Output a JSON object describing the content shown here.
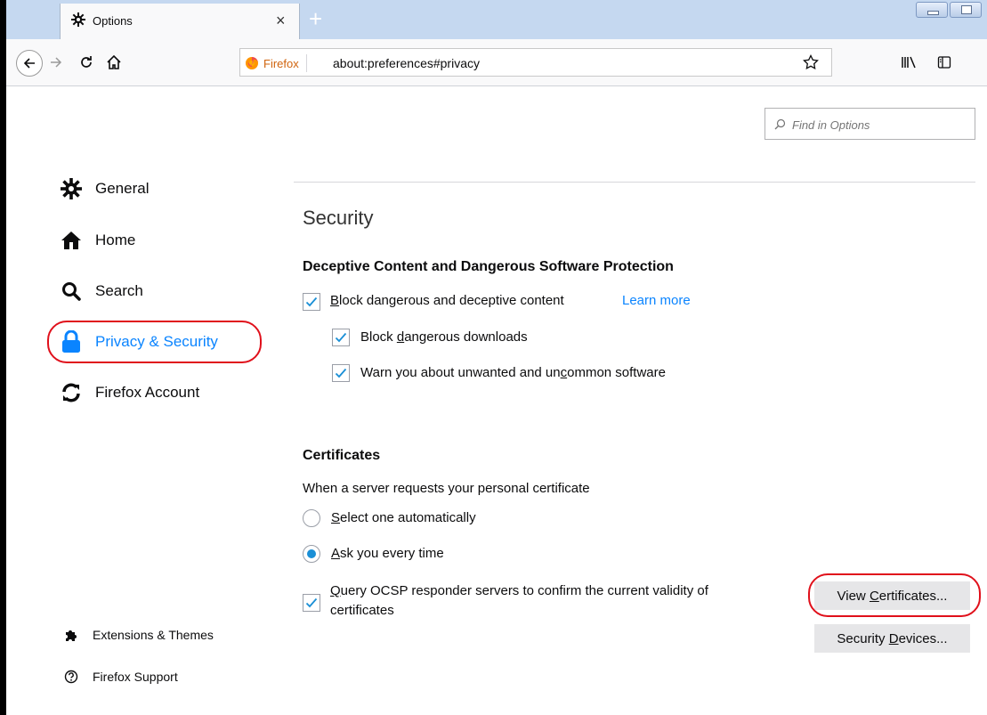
{
  "tab": {
    "title": "Options",
    "close": "×",
    "new_tab": "+"
  },
  "toolbar": {
    "identity_label": "Firefox",
    "url": "about:preferences#privacy"
  },
  "search": {
    "placeholder": "Find in Options"
  },
  "sidebar": {
    "items": [
      {
        "label": "General",
        "icon": "gear-icon"
      },
      {
        "label": "Home",
        "icon": "home-icon"
      },
      {
        "label": "Search",
        "icon": "search-icon"
      },
      {
        "label": "Privacy & Security",
        "icon": "lock-icon",
        "selected": true
      },
      {
        "label": "Firefox Account",
        "icon": "sync-icon"
      }
    ],
    "footer": [
      {
        "label": "Extensions & Themes",
        "icon": "puzzle-icon"
      },
      {
        "label": "Firefox Support",
        "icon": "help-icon"
      }
    ]
  },
  "security": {
    "heading": "Security",
    "deceptive": {
      "heading": "Deceptive Content and Dangerous Software Protection",
      "block_pre": "",
      "block_key": "B",
      "block_post": "lock dangerous and deceptive content",
      "learn_more": "Learn more",
      "downloads_pre": "Block ",
      "downloads_key": "d",
      "downloads_post": "angerous downloads",
      "warn_pre": "Warn you about unwanted and un",
      "warn_key": "c",
      "warn_post": "ommon software"
    },
    "certificates": {
      "heading": "Certificates",
      "description": "When a server requests your personal certificate",
      "auto_pre": "",
      "auto_key": "S",
      "auto_post": "elect one automatically",
      "ask_pre": "",
      "ask_key": "A",
      "ask_post": "sk you every time",
      "ocsp_pre": "",
      "ocsp_key": "Q",
      "ocsp_post": "uery OCSP responder servers to confirm the current validity of",
      "ocsp_line2": "certificates",
      "view_pre": "View ",
      "view_key": "C",
      "view_post": "ertificates...",
      "devices_pre": "Security ",
      "devices_key": "D",
      "devices_post": "evices..."
    }
  },
  "colors": {
    "accent": "#0a84ff",
    "highlight_ring": "#e0101b",
    "titlebar": "#c5d8f0"
  }
}
